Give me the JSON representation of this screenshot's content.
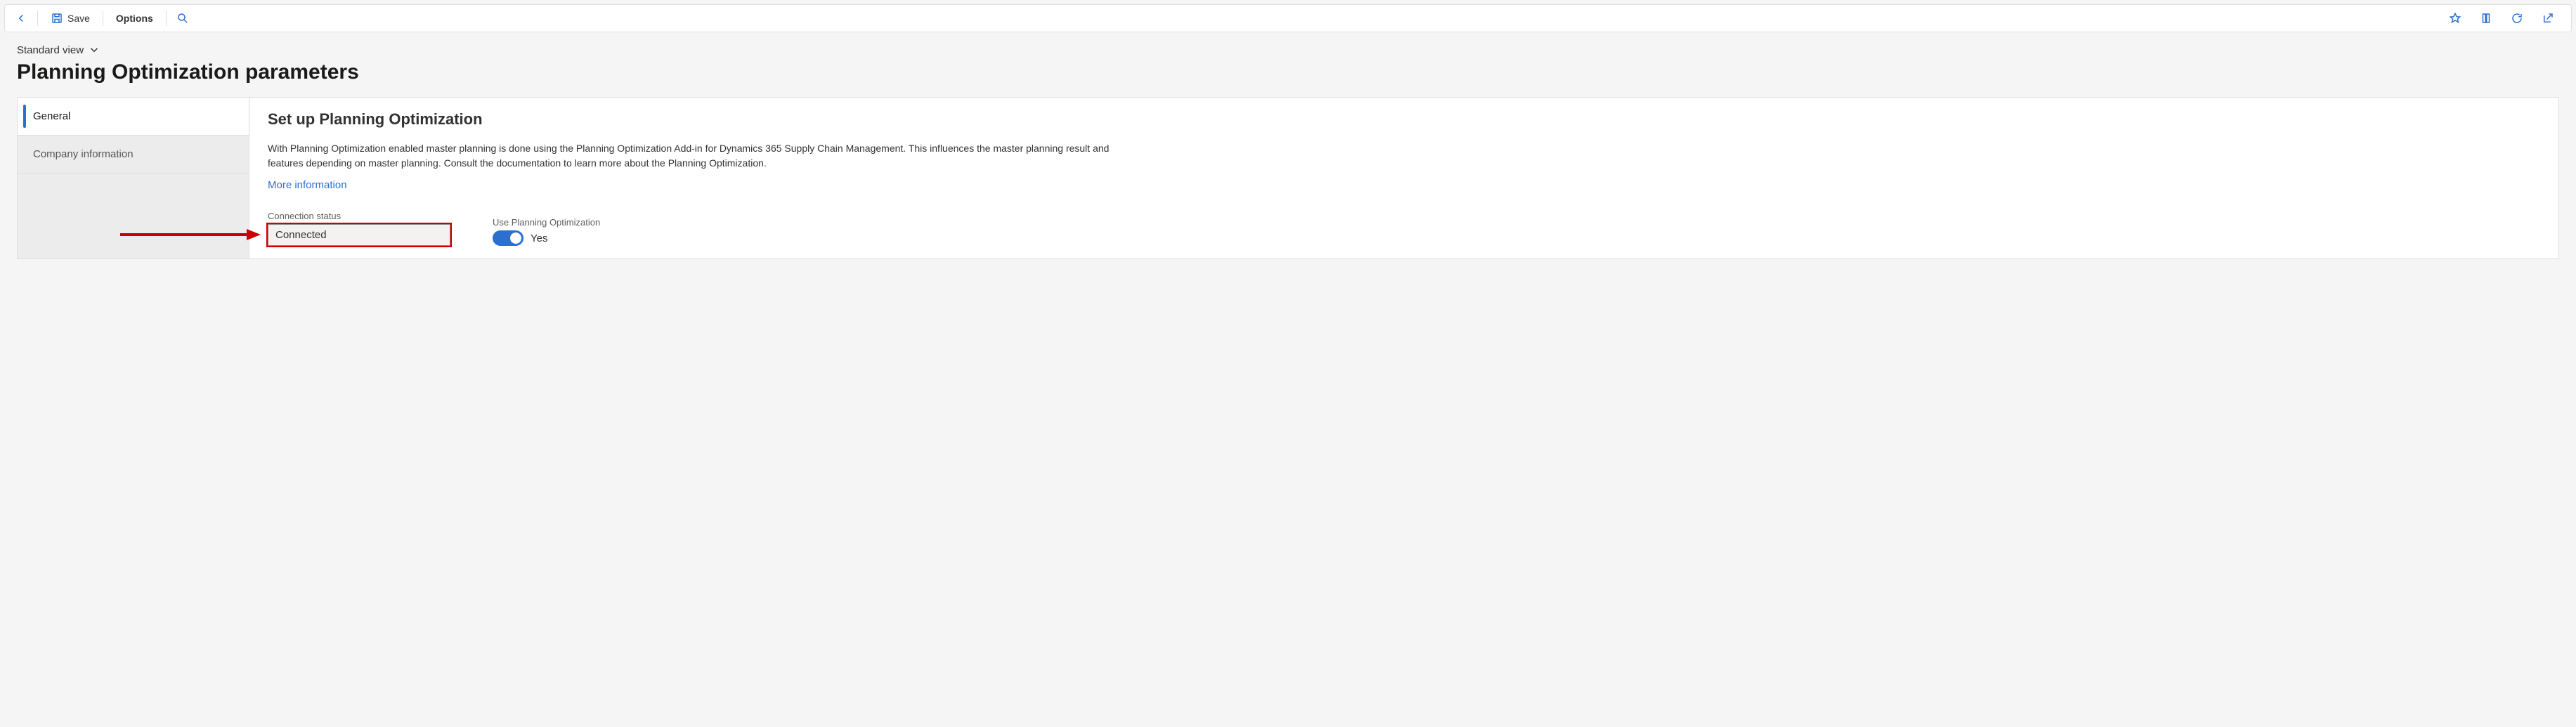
{
  "toolbar": {
    "save_label": "Save",
    "options_label": "Options"
  },
  "header": {
    "view_label": "Standard view",
    "page_title": "Planning Optimization parameters"
  },
  "tabs": [
    {
      "label": "General"
    },
    {
      "label": "Company information"
    }
  ],
  "section": {
    "title": "Set up Planning Optimization",
    "description": "With Planning Optimization enabled master planning is done using the Planning Optimization Add-in for Dynamics 365 Supply Chain Management. This influences the master planning result and features depending on master planning. Consult the documentation to learn more about the Planning Optimization.",
    "more_link": "More information"
  },
  "fields": {
    "connection_status_label": "Connection status",
    "connection_status_value": "Connected",
    "use_po_label": "Use Planning Optimization",
    "use_po_value": "Yes"
  }
}
